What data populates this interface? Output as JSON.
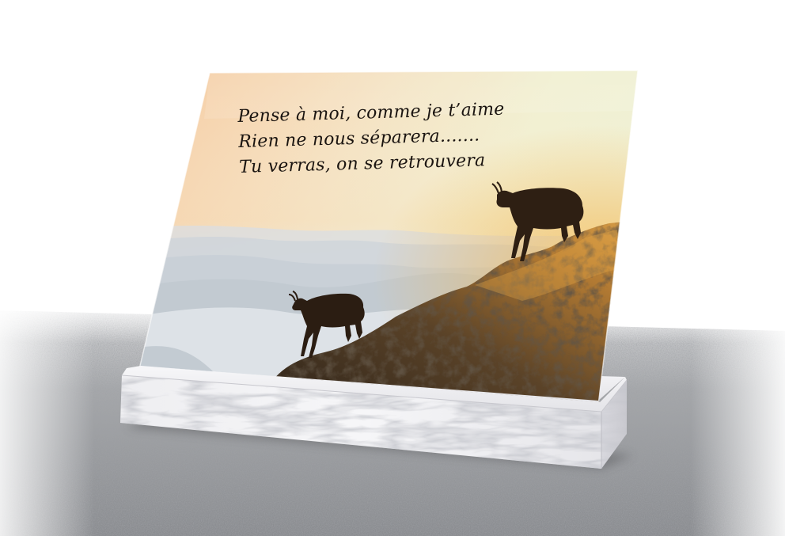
{
  "plaque": {
    "poem_lines": [
      "Pense à moi, comme je t’aime",
      "Rien ne nous séparera.......",
      "Tu verras, on se retrouvera"
    ]
  },
  "colors": {
    "sky_warm": "#f6c99a",
    "sky_light": "#f3f1d6",
    "haze": "#e6ecef",
    "rock_dark": "#3a2c1e",
    "rock_lit": "#d9973a",
    "marble": "#f1f1f3",
    "granite": "#8f9296"
  },
  "icons": [
    "chamois-silhouette",
    "chamois-silhouette"
  ]
}
